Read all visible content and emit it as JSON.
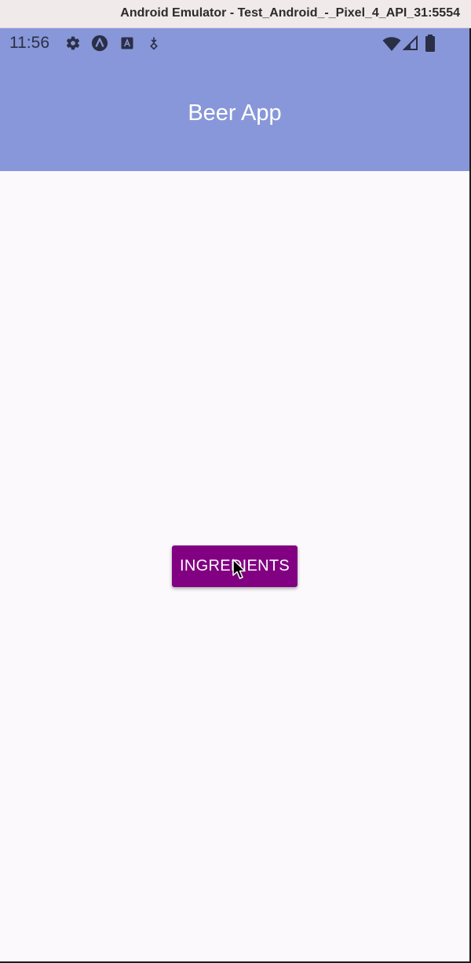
{
  "window": {
    "title": "Android Emulator - Test_Android_-_Pixel_4_API_31:5554"
  },
  "status_bar": {
    "time": "11:56",
    "left_icons": [
      "settings-icon",
      "android-studio-icon",
      "keyboard-a-icon",
      "download-icon"
    ],
    "right_icons": [
      "wifi-icon",
      "cellular-signal-icon",
      "battery-icon"
    ]
  },
  "app_bar": {
    "title": "Beer App"
  },
  "main": {
    "button_label": "INGREDIENTS"
  },
  "colors": {
    "app_bar": "#8897d9",
    "button": "#820082",
    "background": "#fcf9fd"
  }
}
